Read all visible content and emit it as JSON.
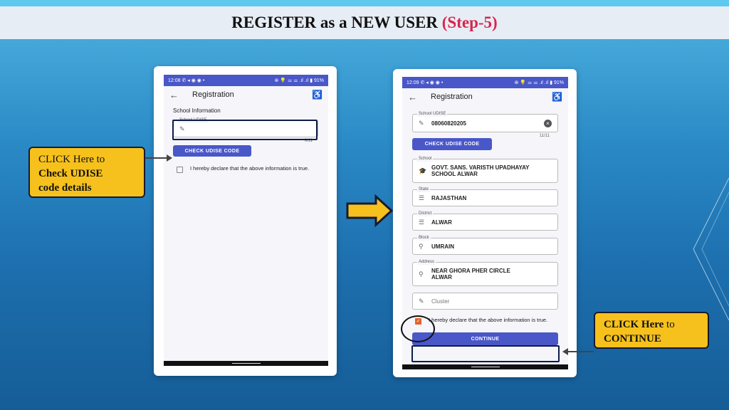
{
  "header": {
    "title": "REGISTER as a NEW USER",
    "step": "(Step-5)"
  },
  "phone_left": {
    "status": {
      "time": "12:08",
      "icons": "✆ ◂ ◉ ◉ •",
      "right": "⊛ 💡 ⚌ ⚌ .ıl .ıl ▮ 91%"
    },
    "app_bar": {
      "title": "Registration"
    },
    "section_title": "School Information",
    "udise_field": {
      "label": "School UDISE",
      "value": "",
      "counter": "0/11"
    },
    "check_button": "CHECK UDISE CODE",
    "declaration": "I hereby declare that the above information is true.",
    "declaration_checked": false
  },
  "phone_right": {
    "status": {
      "time": "12:09",
      "icons": "✆ ◂ ◉ ◉ •",
      "right": "⊛ 💡 ⚌ ⚌ .ıl .ıl ▮ 91%"
    },
    "app_bar": {
      "title": "Registration"
    },
    "udise_field": {
      "label": "School UDISE",
      "value": "08060820205",
      "counter": "11/11"
    },
    "check_button": "CHECK UDISE CODE",
    "fields": [
      {
        "label": "School",
        "value": "GOVT.  SANS. VARISTH UPADHAYAY SCHOOL ALWAR",
        "icon": "graduation-cap-icon"
      },
      {
        "label": "State",
        "value": "RAJASTHAN",
        "icon": "list-icon"
      },
      {
        "label": "District",
        "value": "ALWAR",
        "icon": "list-icon"
      },
      {
        "label": "Block",
        "value": "UMRAIN",
        "icon": "location-pin-icon"
      },
      {
        "label": "Address",
        "value": "NEAR GHORA PHER CIRCLE ALWAR",
        "icon": "location-pin-icon"
      }
    ],
    "cluster_placeholder": "Cluster",
    "declaration": "I hereby declare that the above information is true.",
    "declaration_checked": true,
    "continue_button": "CONTINUE"
  },
  "callouts": {
    "left": {
      "line1": "CLICK Here to",
      "line2": "Check UDISE",
      "line3": "code details"
    },
    "right": {
      "bold": "CLICK Here",
      "normal": " to",
      "line2": "CONTINUE"
    }
  },
  "colors": {
    "accent": "#4957c8",
    "callout": "#f6c11d",
    "step": "#d6264e",
    "checkbox": "#e0642b"
  }
}
